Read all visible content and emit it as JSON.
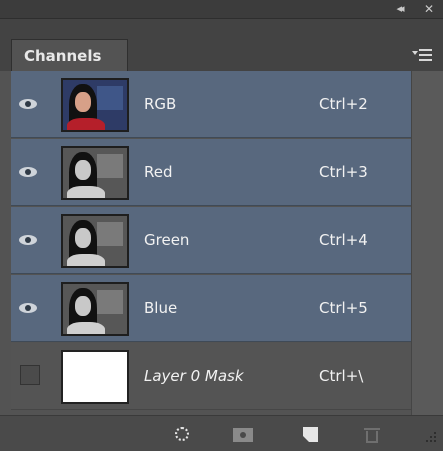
{
  "panel": {
    "tab_label": "Channels",
    "header_icons": [
      "collapse-double-arrow-icon",
      "close-icon"
    ],
    "collapse_glyph": "◂◂",
    "close_glyph": "✕"
  },
  "channels": [
    {
      "name": "RGB",
      "shortcut": "Ctrl+2",
      "visible": true,
      "selected": true,
      "thumbnail": "color-portrait"
    },
    {
      "name": "Red",
      "shortcut": "Ctrl+3",
      "visible": true,
      "selected": true,
      "thumbnail": "grayscale-portrait"
    },
    {
      "name": "Green",
      "shortcut": "Ctrl+4",
      "visible": true,
      "selected": true,
      "thumbnail": "grayscale-portrait"
    },
    {
      "name": "Blue",
      "shortcut": "Ctrl+5",
      "visible": true,
      "selected": true,
      "thumbnail": "grayscale-portrait"
    },
    {
      "name": "Layer 0 Mask",
      "shortcut": "Ctrl+\\",
      "visible": false,
      "selected": false,
      "thumbnail": "white-mask"
    }
  ],
  "toolbar": {
    "buttons": [
      "load-channel-as-selection-icon",
      "save-selection-as-channel-icon",
      "new-channel-icon",
      "delete-channel-icon"
    ]
  },
  "colors": {
    "panel_bg": "#535353",
    "selected_row": "#58687e",
    "unselected_row": "#545454",
    "text": "#f2f2f2"
  }
}
